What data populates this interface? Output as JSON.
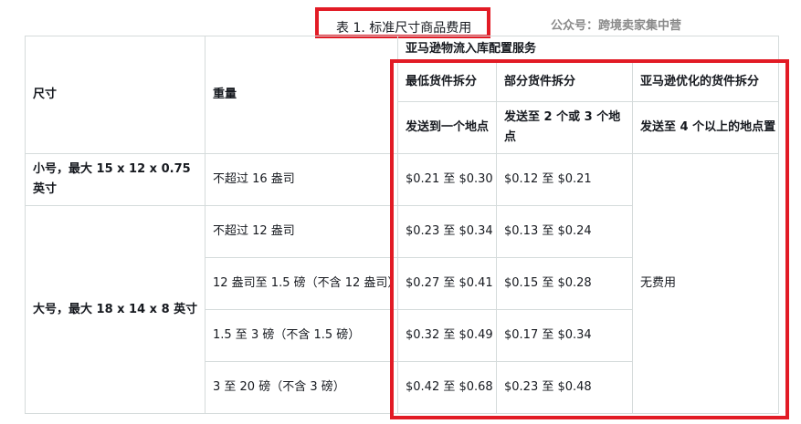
{
  "caption": "表 1. 标准尺寸商品费用",
  "watermark": "公众号：跨境卖家集中营",
  "headers": {
    "size": "尺寸",
    "weight": "重量",
    "service": "亚马逊物流入库配置服务",
    "min_split": "最低货件拆分",
    "partial_split": "部分货件拆分",
    "optimized_split": "亚马逊优化的货件拆分",
    "min_desc": "发送到一个地点",
    "partial_desc": "发送至 2 个或 3 个地点",
    "optimized_desc": "发送至 4 个以上的地点置"
  },
  "sizes": {
    "small": "小号，最大 15 x 12 x 0.75 英寸",
    "large": "大号，最大 18 x 14 x 8 英寸"
  },
  "rows": [
    {
      "weight": "不超过 16 盎司",
      "min": "$0.21 至 $0.30",
      "partial": "$0.12 至 $0.21"
    },
    {
      "weight": "不超过 12 盎司",
      "min": "$0.23 至 $0.34",
      "partial": "$0.13 至 $0.24"
    },
    {
      "weight": "12 盎司至 1.5 磅（不含 12 盎司）",
      "min": "$0.27 至 $0.41",
      "partial": "$0.15 至 $0.28"
    },
    {
      "weight": "1.5 至 3 磅（不含 1.5 磅）",
      "min": "$0.32 至 $0.49",
      "partial": "$0.17 至 $0.34"
    },
    {
      "weight": "3 至 20 磅（不含 3 磅）",
      "min": "$0.42 至 $0.68",
      "partial": "$0.23 至 $0.48"
    }
  ],
  "no_fee": "无费用"
}
